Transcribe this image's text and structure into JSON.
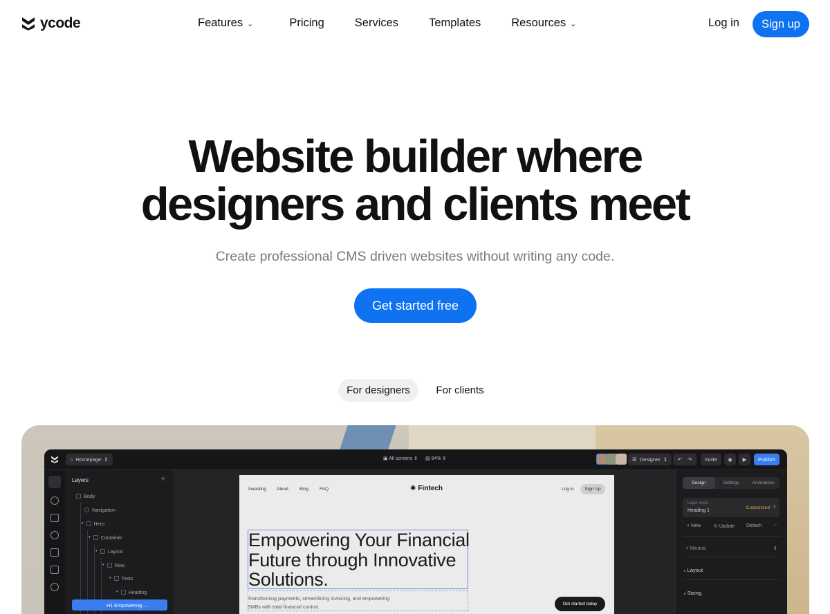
{
  "nav": {
    "logo_text": "ycode",
    "links": [
      "Features",
      "Pricing",
      "Services",
      "Templates",
      "Resources"
    ],
    "login": "Log in",
    "signup": "Sign up"
  },
  "hero": {
    "title_line1": "Website builder where",
    "title_line2": "designers and clients meet",
    "subtitle": "Create professional CMS driven websites without writing any code.",
    "cta": "Get started free"
  },
  "segments": {
    "designers": "For designers",
    "clients": "For clients"
  },
  "editor": {
    "page_selector": "Homepage",
    "screens": "All screens",
    "zoom": "84%",
    "mode": "Designer",
    "invite": "Invite",
    "publish": "Publish",
    "layers_title": "Layers",
    "layers": [
      "Body",
      "Navigation",
      "Hero",
      "Container",
      "Layout",
      "Row",
      "Texts",
      "Heading",
      "H1  Empowering ..."
    ],
    "right_panel": {
      "tabs": [
        "Design",
        "Settings",
        "Animations"
      ],
      "layer_style_label": "Layer style:",
      "layer_style_value": "Heading 1",
      "customized": "Customized",
      "actions": [
        "+ New",
        "Update",
        "Detach"
      ],
      "color_value": "Neutral",
      "sections": [
        "Layout",
        "Sizing"
      ]
    },
    "site": {
      "nav_links": [
        "Investing",
        "About",
        "Blog",
        "FAQ"
      ],
      "logo": "Fintech",
      "login": "Log in",
      "signup": "Sign Up",
      "headline": "Empowering Your Financial Future through Innovative Solutions.",
      "paragraph": "Transforming payments, streamlining invoicing, and empowering SMBs with total financial control.",
      "cta": "Get started today"
    }
  }
}
